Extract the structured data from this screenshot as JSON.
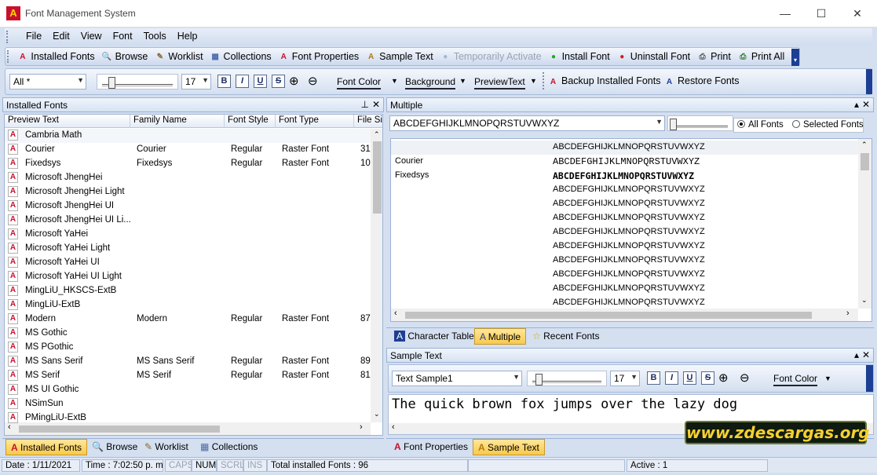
{
  "window": {
    "title": "Font Management System",
    "min": "—",
    "max": "☐",
    "close": "✕"
  },
  "menu": [
    "File",
    "Edit",
    "View",
    "Font",
    "Tools",
    "Help"
  ],
  "toolbar": [
    {
      "label": "Installed Fonts",
      "icon": "installed-fonts-icon",
      "color": "#c8102e",
      "glyph": "A",
      "enabled": true
    },
    {
      "label": "Browse",
      "icon": "magnifier-icon",
      "color": "#2b5fb3",
      "glyph": "🔍",
      "enabled": true
    },
    {
      "label": "Worklist",
      "icon": "worklist-icon",
      "color": "#8a6a30",
      "glyph": "✎",
      "enabled": true
    },
    {
      "label": "Collections",
      "icon": "collections-icon",
      "color": "#4b6aa8",
      "glyph": "▦",
      "enabled": true
    },
    {
      "label": "Font Properties",
      "icon": "font-properties-icon",
      "color": "#c8102e",
      "glyph": "A",
      "enabled": true
    },
    {
      "label": "Sample Text",
      "icon": "sample-text-icon",
      "color": "#b07b10",
      "glyph": "A",
      "enabled": true
    },
    {
      "label": "Temporarily Activate",
      "icon": "activate-icon",
      "color": "#9fb6d6",
      "glyph": "●",
      "enabled": false
    },
    {
      "label": "Install Font",
      "icon": "install-font-icon",
      "color": "#1fa81f",
      "glyph": "●",
      "enabled": true
    },
    {
      "label": "Uninstall Font",
      "icon": "uninstall-font-icon",
      "color": "#d61a1a",
      "glyph": "●",
      "enabled": true
    },
    {
      "label": "Print",
      "icon": "printer-icon",
      "color": "#555",
      "glyph": "⎙",
      "enabled": true
    },
    {
      "label": "Print All",
      "icon": "print-all-icon",
      "color": "#2a7a2a",
      "glyph": "⎙",
      "enabled": true
    }
  ],
  "toolbar2": {
    "filter": "All *",
    "size": "17",
    "font_color": "Font Color",
    "background": "Background",
    "preview_text": "PreviewText",
    "backup": "Backup Installed Fonts",
    "restore": "Restore Fonts",
    "bold": "B",
    "italic": "I",
    "underline": "U",
    "strike": "S"
  },
  "installed_panel": {
    "title": "Installed Fonts",
    "pin": "📌",
    "close": "✕",
    "columns": [
      "Preview Text",
      "Family Name",
      "Font Style",
      "Font Type",
      "File Siz"
    ],
    "rows": [
      [
        "Cambria Math",
        "",
        "",
        "",
        ""
      ],
      [
        "Courier",
        "Courier",
        "Regular",
        "Raster Font",
        "31"
      ],
      [
        "Fixedsys",
        "Fixedsys",
        "Regular",
        "Raster Font",
        "10"
      ],
      [
        "Microsoft JhengHei",
        "",
        "",
        "",
        ""
      ],
      [
        "Microsoft JhengHei Light",
        "",
        "",
        "",
        ""
      ],
      [
        "Microsoft JhengHei UI",
        "",
        "",
        "",
        ""
      ],
      [
        "Microsoft JhengHei UI Li...",
        "",
        "",
        "",
        ""
      ],
      [
        "Microsoft YaHei",
        "",
        "",
        "",
        ""
      ],
      [
        "Microsoft YaHei Light",
        "",
        "",
        "",
        ""
      ],
      [
        "Microsoft YaHei UI",
        "",
        "",
        "",
        ""
      ],
      [
        "Microsoft YaHei UI Light",
        "",
        "",
        "",
        ""
      ],
      [
        "MingLiU_HKSCS-ExtB",
        "",
        "",
        "",
        ""
      ],
      [
        "MingLiU-ExtB",
        "",
        "",
        "",
        ""
      ],
      [
        "Modern",
        "Modern",
        "Regular",
        "Raster Font",
        "87"
      ],
      [
        "MS Gothic",
        "",
        "",
        "",
        ""
      ],
      [
        "MS PGothic",
        "",
        "",
        "",
        ""
      ],
      [
        "MS Sans Serif",
        "MS Sans Serif",
        "Regular",
        "Raster Font",
        "89"
      ],
      [
        "MS Serif",
        "MS Serif",
        "Regular",
        "Raster Font",
        "81"
      ],
      [
        "MS UI Gothic",
        "",
        "",
        "",
        ""
      ],
      [
        "NSimSun",
        "",
        "",
        "",
        ""
      ],
      [
        "PMingLiU-ExtB",
        "",
        "",
        "",
        ""
      ]
    ],
    "tabs": [
      "Installed Fonts",
      "Browse",
      "Worklist",
      "Collections"
    ]
  },
  "multiple_panel": {
    "title": "Multiple",
    "close": "✕",
    "text_value": "ABCDEFGHIJKLMNOPQRSTUVWXYZ",
    "radio_all": "All Fonts",
    "radio_selected": "Selected Fonts",
    "rows": [
      [
        "",
        "ABCDEFGHIJKLMNOPQRSTUVWXYZ"
      ],
      [
        "Courier",
        "ABCDEFGHIJKLMNOPQRSTUVWXYZ"
      ],
      [
        "Fixedsys",
        "ABCDEFGHIJKLMNOPQRSTUVWXYZ"
      ],
      [
        "",
        "ABCDEFGHIJKLMNOPQRSTUVWXYZ"
      ],
      [
        "",
        "ABCDEFGHIJKLMNOPQRSTUVWXYZ"
      ],
      [
        "",
        "ABCDEFGHIJKLMNOPQRSTUVWXYZ"
      ],
      [
        "",
        "ABCDEFGHIJKLMNOPQRSTUVWXYZ"
      ],
      [
        "",
        "ABCDEFGHIJKLMNOPQRSTUVWXYZ"
      ],
      [
        "",
        "ABCDEFGHIJKLMNOPQRSTUVWXYZ"
      ],
      [
        "",
        "ABCDEFGHIJKLMNOPQRSTUVWXYZ"
      ],
      [
        "",
        "ABCDEFGHIJKLMNOPQRSTUVWXYZ"
      ],
      [
        "",
        "ABCDEFGHIJKLMNOPQRSTUVWXYZ"
      ]
    ],
    "tabs": [
      "Character Table",
      "Multiple",
      "Recent Fonts"
    ]
  },
  "sample_panel": {
    "title": "Sample Text",
    "close": "✕",
    "sample_select": "Text Sample1",
    "size": "17",
    "font_color": "Font Color",
    "bold": "B",
    "italic": "I",
    "underline": "U",
    "strike": "S",
    "text": "The quick brown fox jumps over the lazy dog",
    "tabs": [
      "Font Properties",
      "Sample Text"
    ]
  },
  "watermark": "www.zdescargas.org",
  "status": {
    "date": "Date : 1/11/2021",
    "time": "Time : 7:02:50 p. m.",
    "caps": "CAPS",
    "num": "NUM",
    "scrl": "SCRL",
    "ins": "INS",
    "total": "Total installed Fonts : 96",
    "active": "Active : 1"
  }
}
